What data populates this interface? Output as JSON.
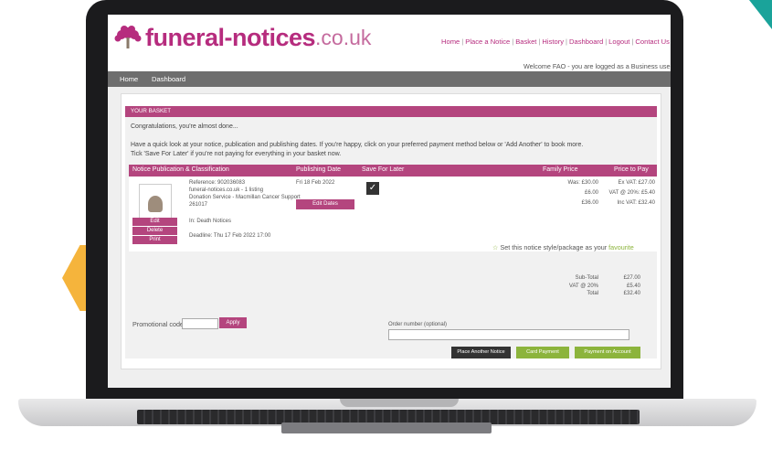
{
  "site": {
    "logo_brand": "funeral-notices",
    "logo_tld": ".co.uk",
    "nav_links": [
      "Home",
      "Place a Notice",
      "Basket",
      "History",
      "Dashboard",
      "Logout",
      "Contact Us"
    ],
    "welcome": "Welcome FAO - you are logged as a Business user",
    "menu": [
      "Home",
      "Dashboard"
    ]
  },
  "basket": {
    "heading": "YOUR BASKET",
    "congrats": "Congratulations, you're almost done...",
    "intro_line1": "Have a quick look at your notice, publication and publishing dates. If you're happy, click on your preferred payment method below or 'Add Another' to book more.",
    "intro_line2": "Tick 'Save For Later' if you're not paying for everything in your basket now.",
    "columns": [
      "Notice Publication & Classification",
      "Publishing Date",
      "Save For Later",
      "Family Price",
      "Price to Pay"
    ],
    "item": {
      "reference": "Reference: 902036083",
      "listing": "funeral-notices.co.uk - 1 listing",
      "donation": "Donation Service - Macmillan Cancer Support",
      "code": "261017",
      "classification": "In: Death Notices",
      "deadline": "Deadline: Thu 17 Feb 2022 17:00",
      "publishing_date": "Fri 18 Feb 2022",
      "edit_dates": "Edit Dates",
      "actions": [
        "Edit",
        "Delete",
        "Print"
      ],
      "family_price": [
        "Was: £30.00",
        "£6.00",
        "£36.00"
      ],
      "price_to_pay": [
        "Ex VAT: £27.00",
        "VAT @ 20%: £5.40",
        "Inc VAT: £32.40"
      ]
    },
    "favourite_prefix": "Set this notice style/package as your ",
    "favourite_link": "favourite",
    "totals": {
      "labels": [
        "Sub-Total",
        "VAT @ 20%",
        "Total"
      ],
      "values": [
        "£27.00",
        "£5.40",
        "£32.40"
      ]
    },
    "promo_label": "Promotional code",
    "apply_label": "Apply",
    "order_label": "Order number (optional)",
    "buttons": {
      "place_another": "Place Another Notice",
      "card_payment": "Card Payment",
      "payment_on_account": "Payment on Account"
    }
  },
  "colors": {
    "brand": "#b62c7e",
    "header_pink": "#b4457e",
    "nav_grey": "#6e6e6e",
    "green": "#8cb43c",
    "teal": "#1aa39a",
    "hexagon": "#f5b43c"
  }
}
